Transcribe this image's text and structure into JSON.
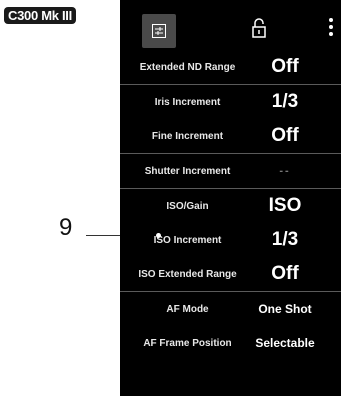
{
  "badge": "C300 Mk III",
  "callout": "9",
  "menu": {
    "groups": [
      {
        "rows": [
          {
            "label": "Extended ND Range",
            "value": "Off"
          }
        ]
      },
      {
        "rows": [
          {
            "label": "Iris Increment",
            "value": "1/3"
          },
          {
            "label": "Fine Increment",
            "value": "Off"
          }
        ]
      },
      {
        "rows": [
          {
            "label": "Shutter Increment",
            "value": "--"
          }
        ]
      },
      {
        "rows": [
          {
            "label": "ISO/Gain",
            "value": "ISO"
          },
          {
            "label": "ISO Increment",
            "value": "1/3"
          },
          {
            "label": "ISO Extended Range",
            "value": "Off"
          }
        ]
      },
      {
        "rows": [
          {
            "label": "AF Mode",
            "value": "One Shot"
          },
          {
            "label": "AF Frame Position",
            "value": "Selectable"
          }
        ]
      }
    ]
  },
  "icons": {
    "tab": "menu-tab-icon",
    "lock": "unlock-icon",
    "more": "more-vertical-icon"
  }
}
